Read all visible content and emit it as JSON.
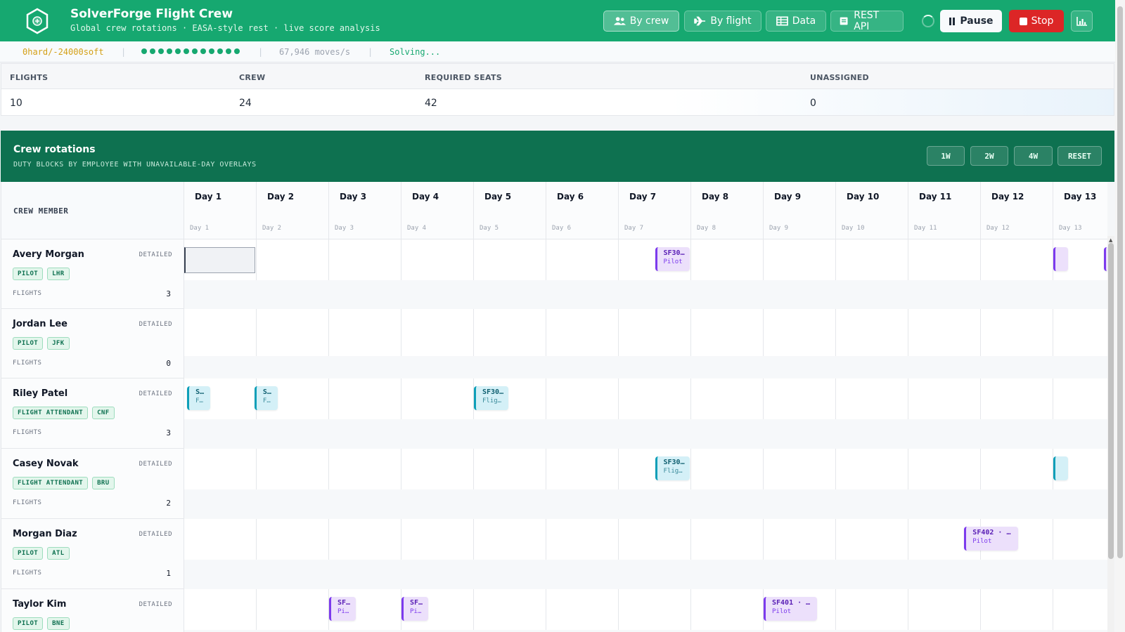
{
  "app": {
    "title": "SolverForge Flight Crew",
    "subtitle": "Global crew rotations · EASA-style rest · live score analysis"
  },
  "nav": [
    {
      "label": "By crew",
      "icon": "users-icon",
      "active": true
    },
    {
      "label": "By flight",
      "icon": "plane-icon",
      "active": false
    },
    {
      "label": "Data",
      "icon": "table-icon",
      "active": false
    },
    {
      "label": "REST API",
      "icon": "document-icon",
      "active": false
    }
  ],
  "controls": {
    "pause_label": "Pause",
    "stop_label": "Stop",
    "chart_icon": "bar-chart-icon"
  },
  "status": {
    "score": "0hard/-24000soft",
    "moves": "67,946 moves/s",
    "state": "Solving...",
    "progress_dots": 12
  },
  "stats": [
    {
      "label": "FLIGHTS",
      "value": "10"
    },
    {
      "label": "CREW",
      "value": "24"
    },
    {
      "label": "REQUIRED SEATS",
      "value": "42"
    },
    {
      "label": "UNASSIGNED",
      "value": "0"
    }
  ],
  "rotations": {
    "title": "Crew rotations",
    "subtitle": "DUTY BLOCKS BY EMPLOYEE WITH UNAVAILABLE-DAY OVERLAYS",
    "zoom": [
      "1W",
      "2W",
      "4W",
      "RESET"
    ],
    "corner_label": "CREW MEMBER",
    "days": [
      {
        "label": "Day 1",
        "sub": "Day 1"
      },
      {
        "label": "Day 2",
        "sub": "Day 2"
      },
      {
        "label": "Day 3",
        "sub": "Day 3"
      },
      {
        "label": "Day 4",
        "sub": "Day 4"
      },
      {
        "label": "Day 5",
        "sub": "Day 5"
      },
      {
        "label": "Day 6",
        "sub": "Day 6"
      },
      {
        "label": "Day 7",
        "sub": "Day 7"
      },
      {
        "label": "Day 8",
        "sub": "Day 8"
      },
      {
        "label": "Day 9",
        "sub": "Day 9"
      },
      {
        "label": "Day 10",
        "sub": "Day 10"
      },
      {
        "label": "Day 11",
        "sub": "Day 11"
      },
      {
        "label": "Day 12",
        "sub": "Day 12"
      },
      {
        "label": "Day 13",
        "sub": "Day 13"
      }
    ],
    "flights_label": "FLIGHTS",
    "detail_label": "DETAILED",
    "crew": [
      {
        "name": "Avery Morgan",
        "tags": [
          "PILOT",
          "LHR"
        ],
        "flights": "3",
        "blocks": [
          {
            "day": 6,
            "offset": 0.5,
            "w": 0.48,
            "title": "SF30…",
            "role": "Pilot",
            "kind": "pilot"
          },
          {
            "day": 12,
            "offset": 0.0,
            "w": 0.2,
            "title": "",
            "role": "",
            "kind": "pilot"
          },
          {
            "day": 12,
            "offset": 0.7,
            "w": 0.1,
            "title": "",
            "role": "",
            "kind": "pilot"
          }
        ]
      },
      {
        "name": "Jordan Lee",
        "tags": [
          "PILOT",
          "JFK"
        ],
        "flights": "0",
        "blocks": []
      },
      {
        "name": "Riley Patel",
        "tags": [
          "FLIGHT ATTENDANT",
          "CNF"
        ],
        "flights": "3",
        "blocks": [
          {
            "day": 0,
            "offset": 0.04,
            "w": 0.32,
            "title": "S…",
            "role": "F…",
            "kind": "fa"
          },
          {
            "day": 0,
            "offset": 0.97,
            "w": 0.32,
            "title": "S…",
            "role": "F…",
            "kind": "fa"
          },
          {
            "day": 4,
            "offset": 0.0,
            "w": 0.48,
            "title": "SF30…",
            "role": "Flig…",
            "kind": "fa"
          }
        ]
      },
      {
        "name": "Casey Novak",
        "tags": [
          "FLIGHT ATTENDANT",
          "BRU"
        ],
        "flights": "2",
        "blocks": [
          {
            "day": 6,
            "offset": 0.5,
            "w": 0.48,
            "title": "SF30…",
            "role": "Flig…",
            "kind": "fa"
          },
          {
            "day": 12,
            "offset": 0.0,
            "w": 0.2,
            "title": "",
            "role": "",
            "kind": "fa"
          }
        ]
      },
      {
        "name": "Morgan Diaz",
        "tags": [
          "PILOT",
          "ATL"
        ],
        "flights": "1",
        "blocks": [
          {
            "day": 10,
            "offset": 0.77,
            "w": 0.74,
            "title": "SF402 · …",
            "role": "Pilot",
            "kind": "pilot"
          }
        ]
      },
      {
        "name": "Taylor Kim",
        "tags": [
          "PILOT",
          "BNE"
        ],
        "flights": "",
        "blocks": [
          {
            "day": 2,
            "offset": 0.0,
            "w": 0.37,
            "title": "SF…",
            "role": "Pi…",
            "kind": "pilot"
          },
          {
            "day": 3,
            "offset": 0.0,
            "w": 0.37,
            "title": "SF…",
            "role": "Pi…",
            "kind": "pilot"
          },
          {
            "day": 8,
            "offset": 0.0,
            "w": 0.74,
            "title": "SF401 · …",
            "role": "Pilot",
            "kind": "pilot"
          }
        ]
      }
    ]
  }
}
